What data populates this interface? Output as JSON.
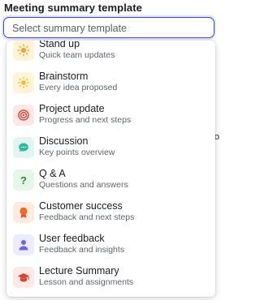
{
  "field": {
    "label": "Meeting summary template",
    "placeholder": "Select summary template"
  },
  "background": {
    "partial_text": "Bo"
  },
  "menu": {
    "items": [
      {
        "title": "Stand up",
        "subtitle": "Quick team updates",
        "icon": "sun-icon"
      },
      {
        "title": "Brainstorm",
        "subtitle": "Every idea proposed",
        "icon": "lightbulb-icon"
      },
      {
        "title": "Project update",
        "subtitle": "Progress and next steps",
        "icon": "target-icon"
      },
      {
        "title": "Discussion",
        "subtitle": "Key points overview",
        "icon": "chat-bubble-icon"
      },
      {
        "title": "Q & A",
        "subtitle": "Questions and answers",
        "icon": "question-mark-icon"
      },
      {
        "title": "Customer success",
        "subtitle": "Feedback and next steps",
        "icon": "award-ribbon-icon"
      },
      {
        "title": "User feedback",
        "subtitle": "Feedback and insights",
        "icon": "user-icon"
      },
      {
        "title": "Lecture Summary",
        "subtitle": "Lesson and assignments",
        "icon": "graduation-cap-icon"
      }
    ]
  },
  "colors": {
    "focus_border": "#3b4fd6",
    "sun": "#f2a33a",
    "target": "#e0483a",
    "chat": "#2fb8a0",
    "question": "#2e8b3c",
    "ribbon": "#ef6a2b",
    "user": "#6b63e8",
    "cap": "#d9432f"
  }
}
